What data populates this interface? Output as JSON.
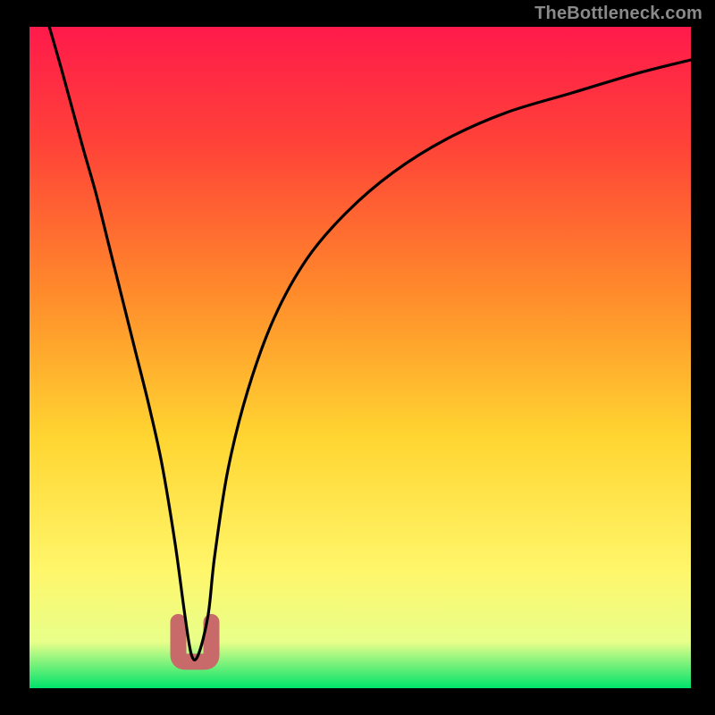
{
  "watermark": "TheBottleneck.com",
  "chart_data": {
    "type": "line",
    "title": "",
    "xlabel": "",
    "ylabel": "",
    "xlim": [
      0,
      100
    ],
    "ylim": [
      0,
      100
    ],
    "grid": false,
    "legend": false,
    "gradient_colors": {
      "top": "#ff1a4b",
      "upper_mid": "#ff8a2b",
      "mid": "#ffd531",
      "lower_mid": "#fff66a",
      "near_bottom": "#e8ff8a",
      "bottom": "#00e36b"
    },
    "series": [
      {
        "name": "bottleneck-curve",
        "color": "#000000",
        "x": [
          3,
          5,
          8,
          10,
          12,
          14,
          16,
          18,
          20,
          22,
          23.5,
          24.5,
          25.5,
          27,
          28,
          30,
          33,
          37,
          42,
          48,
          55,
          63,
          72,
          82,
          92,
          100
        ],
        "y": [
          100,
          93,
          82,
          75,
          67,
          59,
          51,
          43,
          34,
          22,
          11,
          5,
          5,
          11,
          20,
          33,
          45,
          56,
          65,
          72,
          78,
          83,
          87,
          90,
          93,
          95
        ]
      }
    ],
    "marker": {
      "name": "optimal-point",
      "shape": "u",
      "color": "#c96a6a",
      "x": 25,
      "y": 4,
      "width": 5,
      "height": 6
    }
  }
}
